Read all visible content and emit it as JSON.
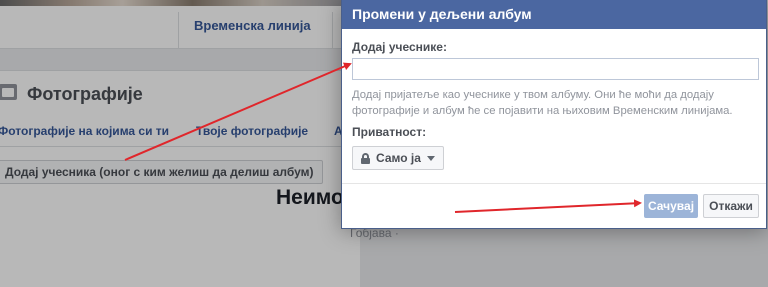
{
  "background": {
    "timeline_link": "Временска линија",
    "photos_title": "Фотографије",
    "tabs": [
      "Фотографије на којима си ти",
      "Твоје фотографије",
      "А"
    ],
    "add_participants_button": "Додај учесника (оног с ким желиш да делиш албум)",
    "album_name_partial": "Неимо",
    "album_meta_partial": "Гобјава ·"
  },
  "dialog": {
    "title": "Промени у дељени албум",
    "participants_label": "Додај учеснике:",
    "participants_value": "",
    "helper_text": "Додај пријатеље као учеснике у твом албуму. Они ће моћи да додају фотографије и албум ће се појавити на њиховим Временским линијама.",
    "privacy_label": "Приватност:",
    "privacy_value": "Само ја",
    "save_label": "Сачувај",
    "cancel_label": "Откажи"
  },
  "icons": {
    "privacy": "lock-icon",
    "dropdown": "caret-down-icon",
    "photos": "photo-album-icon"
  },
  "colors": {
    "header_blue": "#4b67a1",
    "link_blue": "#365899",
    "save_disabled": "#9cb4d8",
    "annotation_arrow": "#e0262b"
  }
}
